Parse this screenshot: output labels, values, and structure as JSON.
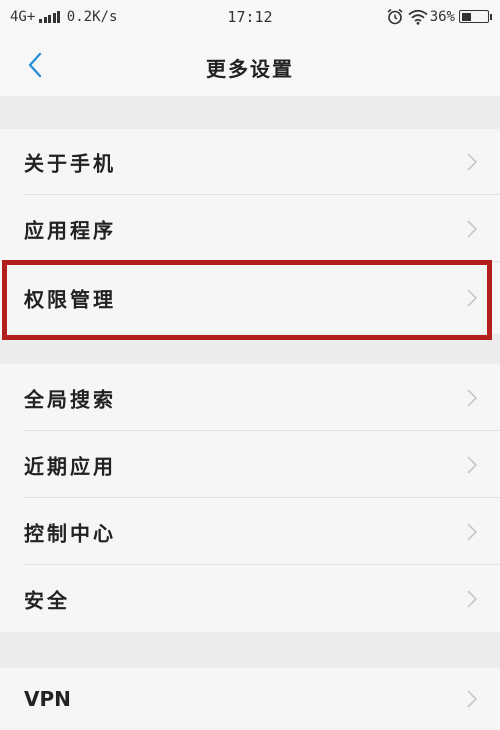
{
  "status_bar": {
    "network": "4G+",
    "speed": "0.2K/s",
    "time": "17:12",
    "battery_percent": "36%",
    "battery_level": 0.36,
    "icons": [
      "signal-icon",
      "alarm-icon",
      "wifi-icon",
      "battery-icon"
    ]
  },
  "header": {
    "title": "更多设置",
    "back_icon": "chevron-left-icon",
    "accent_color": "#2b8fd6"
  },
  "groups": [
    {
      "items": [
        {
          "label": "关于手机"
        },
        {
          "label": "应用程序"
        },
        {
          "label": "权限管理",
          "highlighted": true
        }
      ]
    },
    {
      "items": [
        {
          "label": "全局搜索"
        },
        {
          "label": "近期应用"
        },
        {
          "label": "控制中心"
        },
        {
          "label": "安全"
        }
      ]
    },
    {
      "items": [
        {
          "label": "VPN"
        }
      ]
    }
  ],
  "highlight_color": "#b3201c"
}
